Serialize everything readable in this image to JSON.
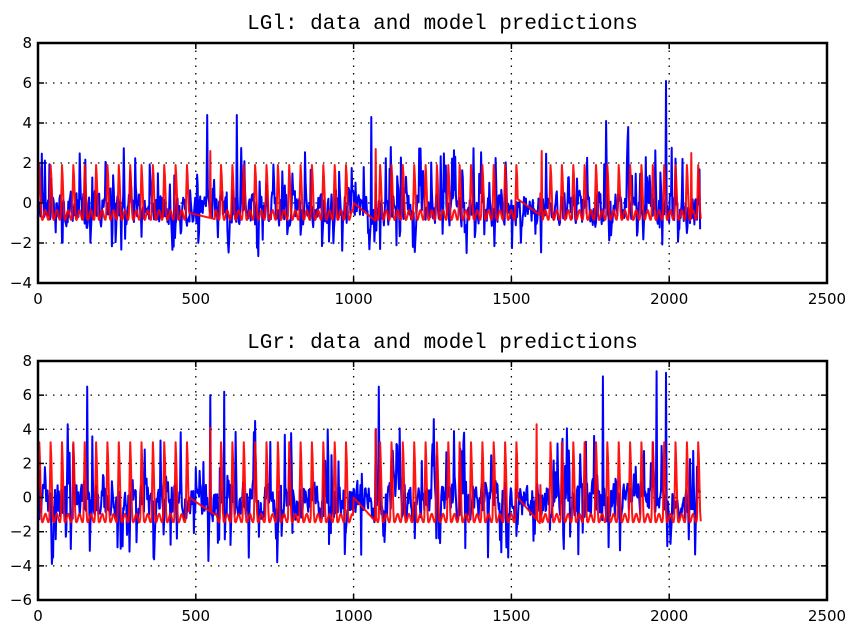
{
  "chart_data": [
    {
      "type": "line",
      "title": "LGl: data and model predictions",
      "xlabel": "",
      "ylabel": "",
      "xlim": [
        0,
        2500
      ],
      "ylim": [
        -4,
        8
      ],
      "xticks": [
        0,
        500,
        1000,
        1500,
        2000,
        2500
      ],
      "yticks": [
        -4,
        -2,
        0,
        2,
        4,
        6,
        8
      ],
      "xtick_labels": [
        "0",
        "500",
        "1000",
        "1500",
        "2000",
        "2500"
      ],
      "ytick_labels": [
        "-4",
        "-2",
        "0",
        "2",
        "4",
        "6",
        "8"
      ],
      "grid": true,
      "legend": null,
      "x_range": [
        0,
        2100
      ],
      "series": [
        {
          "name": "data",
          "color": "#0000ff",
          "generator": {
            "seed": 17,
            "count": 2100,
            "mean": -0.3,
            "spread": 1.2,
            "peak_rate": 0.09,
            "peak_max": 4.4,
            "trough_min": -3.6,
            "notable_peaks": [
              [
                1990,
                6.1
              ],
              [
                1055,
                4.3
              ],
              [
                630,
                4.4
              ],
              [
                535,
                4.4
              ],
              [
                1800,
                4.1
              ],
              [
                1870,
                3.8
              ]
            ]
          }
        },
        {
          "name": "model",
          "color": "#ff0000",
          "generator": {
            "period": 36,
            "low": -0.6,
            "high": 2.1,
            "flat_segments": [
              [
                480,
                560,
                -0.5,
                -0.8
              ],
              [
                1000,
                1070,
                0.0,
                -0.9
              ],
              [
                1520,
                1590,
                0.2,
                -0.6
              ]
            ],
            "high_spikes": [
              [
                545,
                2.6
              ],
              [
                1070,
                2.7
              ],
              [
                1595,
                2.6
              ],
              [
                2070,
                2.5
              ]
            ]
          }
        }
      ]
    },
    {
      "type": "line",
      "title": "LGr: data and model predictions",
      "xlabel": "",
      "ylabel": "",
      "xlim": [
        0,
        2500
      ],
      "ylim": [
        -6,
        8
      ],
      "xticks": [
        0,
        500,
        1000,
        1500,
        2000,
        2500
      ],
      "yticks": [
        -6,
        -4,
        -2,
        0,
        2,
        4,
        6,
        8
      ],
      "xtick_labels": [
        "0",
        "500",
        "1000",
        "1500",
        "2000",
        "2500"
      ],
      "ytick_labels": [
        "-6",
        "-4",
        "-2",
        "0",
        "2",
        "4",
        "6",
        "8"
      ],
      "grid": true,
      "legend": null,
      "x_range": [
        0,
        2100
      ],
      "series": [
        {
          "name": "data",
          "color": "#0000ff",
          "generator": {
            "seed": 43,
            "count": 2100,
            "mean": -0.2,
            "spread": 1.6,
            "peak_rate": 0.09,
            "peak_max": 6.5,
            "trough_min": -5.6,
            "notable_peaks": [
              [
                155,
                6.5
              ],
              [
                1960,
                7.4
              ],
              [
                1990,
                7.3
              ],
              [
                1790,
                7.1
              ],
              [
                1080,
                6.5
              ],
              [
                545,
                6.0
              ],
              [
                590,
                6.2
              ]
            ]
          }
        },
        {
          "name": "model",
          "color": "#ff0000",
          "generator": {
            "period": 36,
            "low": -1.2,
            "high": 3.6,
            "flat_segments": [
              [
                480,
                560,
                0.0,
                -1.0
              ],
              [
                1000,
                1070,
                0.0,
                -1.4
              ],
              [
                1520,
                1590,
                0.0,
                -1.5
              ]
            ],
            "high_spikes": [
              [
                545,
                4.1
              ],
              [
                1070,
                4.0
              ],
              [
                1580,
                4.3
              ]
            ]
          }
        }
      ]
    }
  ]
}
